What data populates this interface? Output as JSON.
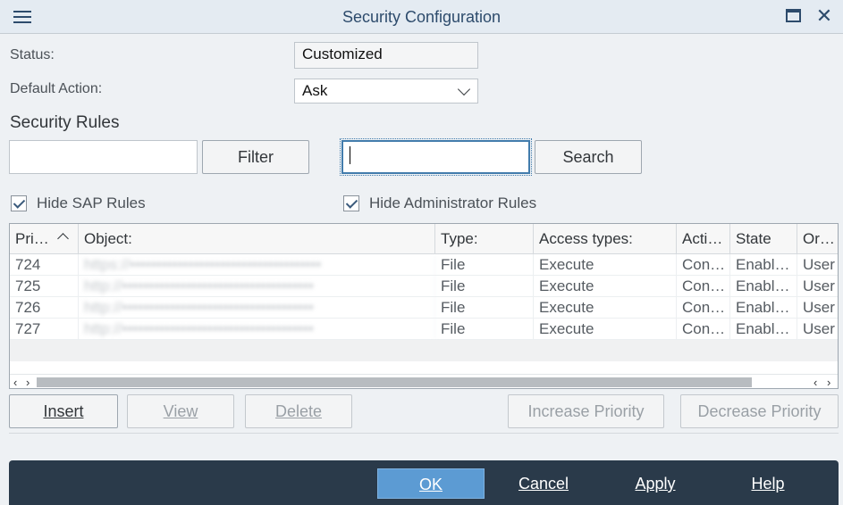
{
  "window": {
    "title": "Security Configuration"
  },
  "form": {
    "status_label": "Status:",
    "status_value": "Customized",
    "default_action_label": "Default Action:",
    "default_action_value": "Ask"
  },
  "rules": {
    "section_title": "Security Rules",
    "filter_input_value": "",
    "filter_button": "Filter",
    "search_input_value": "",
    "search_button": "Search",
    "hide_sap_label": "Hide SAP Rules",
    "hide_sap_checked": true,
    "hide_admin_label": "Hide Administrator Rules",
    "hide_admin_checked": true
  },
  "table": {
    "columns": [
      "Pri…",
      "Object:",
      "Type:",
      "Access types:",
      "Acti…",
      "State",
      "Or…"
    ],
    "rows": [
      {
        "priority": "724",
        "object": "https://••••••••••••••••••••••••••••••••••••",
        "type": "File",
        "access": "Execute",
        "action": "Con…",
        "state": "Enabl…",
        "origin": "User"
      },
      {
        "priority": "725",
        "object": "http://••••••••••••••••••••••••••••••••••••",
        "type": "File",
        "access": "Execute",
        "action": "Con…",
        "state": "Enabl…",
        "origin": "User"
      },
      {
        "priority": "726",
        "object": "http://••••••••••••••••••••••••••••••••••••",
        "type": "File",
        "access": "Execute",
        "action": "Con…",
        "state": "Enabl…",
        "origin": "User"
      },
      {
        "priority": "727",
        "object": "http://••••••••••••••••••••••••••••••••••••",
        "type": "File",
        "access": "Execute",
        "action": "Con…",
        "state": "Enabl…",
        "origin": "User"
      }
    ]
  },
  "actions": {
    "insert": "Insert",
    "view": "View",
    "delete": "Delete",
    "increase_priority": "Increase Priority",
    "decrease_priority": "Decrease Priority"
  },
  "footer": {
    "ok": "OK",
    "cancel": "Cancel",
    "apply": "Apply",
    "help": "Help"
  },
  "colors": {
    "title": "#2d4b6c",
    "footer_bg": "#2a3a4a",
    "primary": "#5c9bd3"
  },
  "icons": {
    "menu": "hamburger-icon",
    "maximize": "maximize-icon",
    "close": "close-icon",
    "dropdown": "chevron-down-icon",
    "sort": "sort-ascending-icon"
  }
}
